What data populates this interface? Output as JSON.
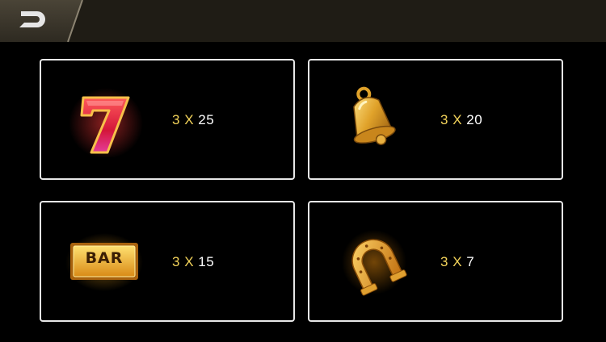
{
  "header": {
    "back_icon": "back-arrow-icon"
  },
  "paytable": [
    {
      "symbol": "seven-symbol-icon",
      "count": "3",
      "times": "X",
      "payout": "25"
    },
    {
      "symbol": "bell-symbol-icon",
      "count": "3",
      "times": "X",
      "payout": "20"
    },
    {
      "symbol": "bar-symbol-icon",
      "label": "BAR",
      "count": "3",
      "times": "X",
      "payout": "15"
    },
    {
      "symbol": "horseshoe-symbol-icon",
      "count": "3",
      "times": "X",
      "payout": "7"
    }
  ],
  "colors": {
    "topbar": "#1f1c15",
    "accent_gold": "#f3d35a",
    "panel_border": "#e8e8e8",
    "seven_red": "#d81e3a",
    "gold": "#e8a92a"
  }
}
